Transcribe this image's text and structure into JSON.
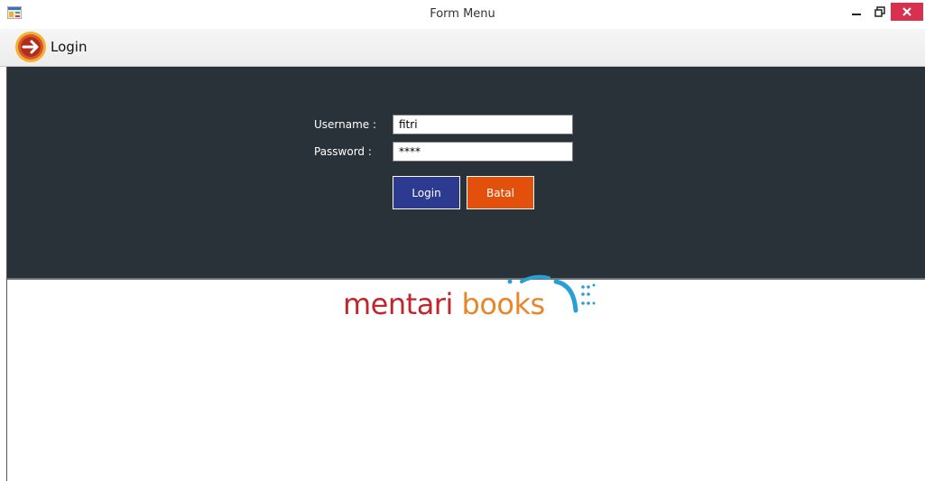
{
  "window": {
    "title": "Form Menu"
  },
  "menu": {
    "login_label": "Login"
  },
  "form": {
    "username_label": "Username :",
    "username_value": "fitri",
    "password_label": "Password :",
    "password_value": "****",
    "login_button": "Login",
    "cancel_button": "Batal"
  },
  "logo": {
    "word1": "mentari",
    "word2": "books"
  },
  "colors": {
    "panel_bg": "#283238",
    "login_button": "#2c3a8f",
    "cancel_button": "#e2500b",
    "close_button": "#d9304e",
    "logo_red": "#c0272d",
    "logo_orange": "#e8862a",
    "logo_blue": "#2a9fd6"
  },
  "icons": {
    "app": "form-app-icon",
    "login": "arrow-right-circle-icon",
    "minimize": "minimize-icon",
    "restore": "restore-icon",
    "close": "close-icon"
  }
}
